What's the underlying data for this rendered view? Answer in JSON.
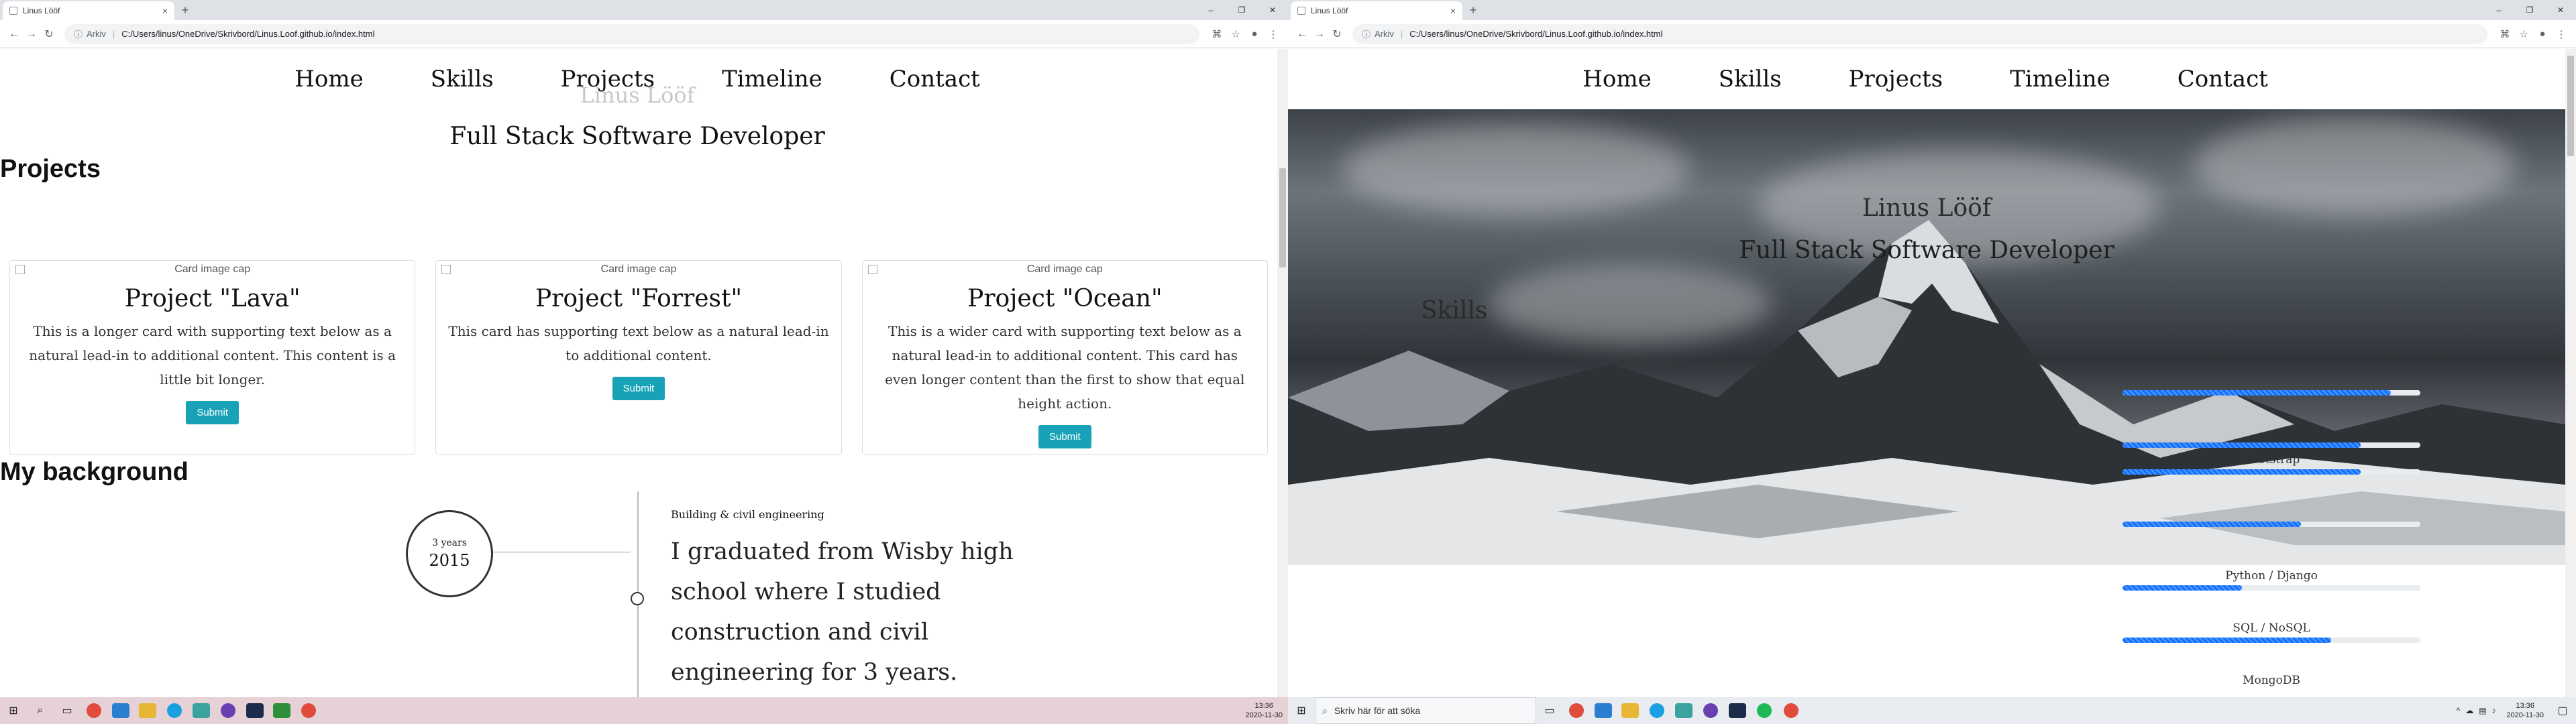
{
  "browser": {
    "tab_title": "Linus Lööf",
    "tab_close": "×",
    "new_tab": "+",
    "url_scheme": "Arkiv",
    "url_path": "C:/Users/linus/OneDrive/Skrivbord/Linus.Loof.github.io/index.html",
    "window_controls": [
      "–",
      "❐",
      "✕"
    ]
  },
  "nav": {
    "items": [
      "Home",
      "Skills",
      "Projects",
      "Timeline",
      "Contact"
    ]
  },
  "left_page": {
    "ghost_name": "Linus Lööf",
    "subtitle": "Full Stack Software Developer",
    "projects_heading": "Projects",
    "cards": [
      {
        "image_alt": "Card image cap",
        "title": "Project \"Lava\"",
        "text": "This is a longer card with supporting text below as a natural lead-in to additional content. This content is a little bit longer.",
        "button": "Submit"
      },
      {
        "image_alt": "Card image cap",
        "title": "Project \"Forrest\"",
        "text": "This card has supporting text below as a natural lead-in to additional content.",
        "button": "Submit"
      },
      {
        "image_alt": "Card image cap",
        "title": "Project \"Ocean\"",
        "text": "This is a wider card with supporting text below as a natural lead-in to additional content. This card has even longer content than the first to show that equal height action.",
        "button": "Submit"
      }
    ],
    "background_heading": "My background",
    "timeline": {
      "duration": "3 years",
      "year": "2015",
      "category": "Building & civil engineering",
      "text": "I graduated from Wisby high school where I studied construction and civil engineering for 3 years."
    }
  },
  "right_page": {
    "hero_name": "Linus Lööf",
    "hero_subtitle": "Full Stack Software Developer",
    "skills_heading": "Skills",
    "skills": [
      {
        "name": "",
        "level": 0.9
      },
      {
        "name": "",
        "level": 0.8
      },
      {
        "name": "Bootstrap",
        "level": 0.8
      },
      {
        "name": "",
        "level": 0.6
      },
      {
        "name": "Python / Django",
        "level": 0.4
      },
      {
        "name": "SQL / NoSQL",
        "level": 0.7
      },
      {
        "name": "MongoDB",
        "level": 0
      }
    ]
  },
  "taskbar": {
    "search_placeholder": "Skriv här för att söka",
    "time": "13:36",
    "date": "2020-11-30"
  },
  "colors": {
    "accent_button": "#17a2b8",
    "progress_fill": "#0d6efd",
    "left_taskbar": "#e6d1d6"
  }
}
